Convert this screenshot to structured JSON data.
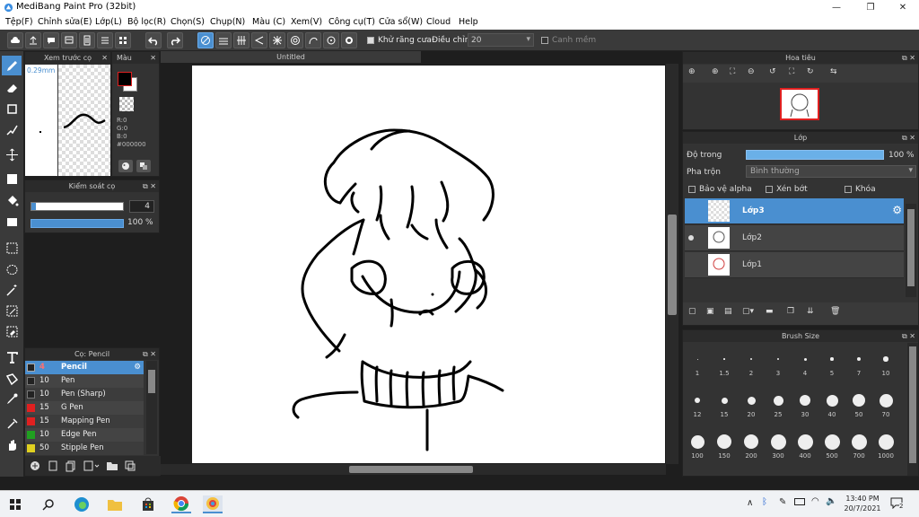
{
  "window": {
    "title": "MediBang Paint Pro (32bit)"
  },
  "menu": [
    "Tệp(F)",
    "Chỉnh sửa(E)",
    "Lớp(L)",
    "Bộ lọc(R)",
    "Chọn(S)",
    "Chụp(N)",
    "Màu (C)",
    "Xem(V)",
    "Công cụ(T)",
    "Cửa sổ(W)",
    "Cloud",
    "Help"
  ],
  "toolbar": {
    "antialias_label": "Khử răng cưa",
    "adjust_label": "Điều chỉnh",
    "adjust_value": "20",
    "snap_label": "Canh mềm"
  },
  "brush_preview": {
    "title": "Xem trước cọ",
    "size": "0.29mm"
  },
  "color_panel": {
    "title": "Màu",
    "r": "R:0",
    "g": "G:0",
    "b": "B:0",
    "hex": "#000000"
  },
  "brush_control": {
    "title": "Kiểm soát cọ",
    "size_value": "4",
    "opacity_value": "100 %"
  },
  "brush_list": {
    "title": "Cọ: Pencil",
    "items": [
      {
        "size": "4",
        "name": "Pencil",
        "color": "#222222"
      },
      {
        "size": "10",
        "name": "Pen",
        "color": "#222222"
      },
      {
        "size": "10",
        "name": "Pen (Sharp)",
        "color": "#222222"
      },
      {
        "size": "15",
        "name": "G Pen",
        "color": "#e02020"
      },
      {
        "size": "15",
        "name": "Mapping Pen",
        "color": "#e02020"
      },
      {
        "size": "10",
        "name": "Edge Pen",
        "color": "#20a020"
      },
      {
        "size": "50",
        "name": "Stipple Pen",
        "color": "#e0d020"
      }
    ]
  },
  "canvas": {
    "tab_title": "Untitled"
  },
  "navigator": {
    "title": "Hoa tiêu"
  },
  "layers": {
    "title": "Lớp",
    "opacity_label": "Độ trong",
    "opacity_value": "100 %",
    "blend_label": "Pha trộn",
    "blend_value": "Bình thường",
    "protect_alpha": "Bảo vệ alpha",
    "clipping": "Xén bớt",
    "lock": "Khóa",
    "items": [
      "Lớp3",
      "Lớp2",
      "Lớp1"
    ]
  },
  "brush_size": {
    "title": "Brush Size",
    "sizes": [
      "1",
      "1.5",
      "2",
      "3",
      "4",
      "5",
      "7",
      "10",
      "12",
      "15",
      "20",
      "25",
      "30",
      "40",
      "50",
      "70",
      "100",
      "150",
      "200",
      "300",
      "400",
      "500",
      "700",
      "1000"
    ]
  },
  "taskbar": {
    "time": "13:40 PM",
    "date": "20/7/2021",
    "notifications": "2"
  },
  "colors": {
    "accent": "#4a8fd0",
    "panel": "#333333",
    "bg": "#1e1e1e"
  }
}
